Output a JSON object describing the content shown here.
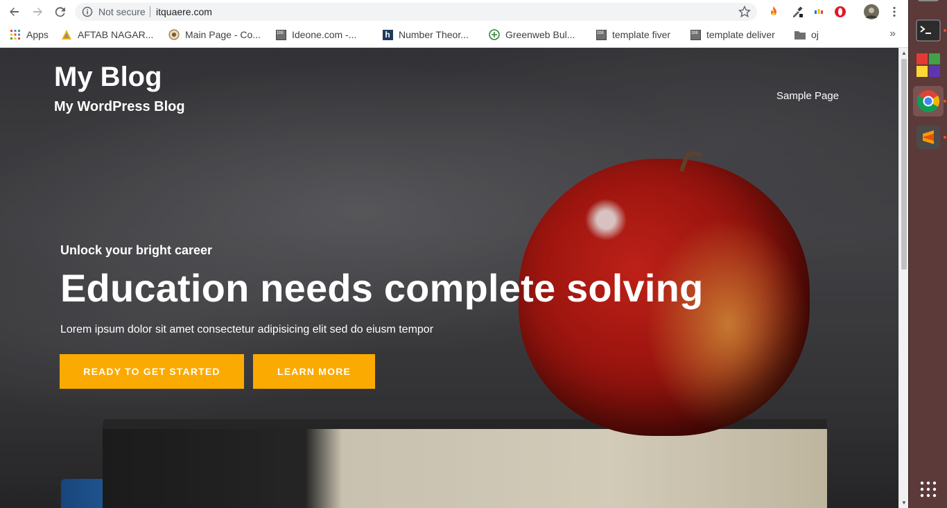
{
  "browser": {
    "security_label": "Not secure",
    "url": "itquaere.com",
    "bookmarks": [
      {
        "label": "Apps",
        "icon": "apps-grid-icon"
      },
      {
        "label": "AFTAB NAGAR...",
        "icon": "triangle-logo-icon"
      },
      {
        "label": "Main Page - Co...",
        "icon": "wiki-icon"
      },
      {
        "label": "Ideone.com -...",
        "icon": "ideone-icon"
      },
      {
        "label": "Number Theor...",
        "icon": "h-icon"
      },
      {
        "label": "Greenweb Bul...",
        "icon": "greenweb-icon"
      },
      {
        "label": "template fiver",
        "icon": "ideone-icon"
      },
      {
        "label": "template deliver",
        "icon": "ideone-icon"
      },
      {
        "label": "oj",
        "icon": "folder-icon"
      }
    ],
    "more_bookmarks": "»"
  },
  "site": {
    "title": "My Blog",
    "tagline": "My WordPress Blog",
    "nav": [
      "Sample Page"
    ]
  },
  "hero": {
    "kicker": "Unlock your bright career",
    "title": "Education needs complete solving",
    "text": "Lorem ipsum dolor sit amet consectetur adipisicing elit sed do eiusm tempor",
    "buttons": [
      "READY TO GET STARTED",
      "LEARN MORE"
    ]
  },
  "colors": {
    "button": "#fbaa01",
    "dock": "#5c3a3a"
  },
  "dock": {
    "items": [
      "terminal-icon",
      "color-grid-icon",
      "chrome-icon",
      "sublime-text-icon",
      "show-apps-icon"
    ]
  }
}
